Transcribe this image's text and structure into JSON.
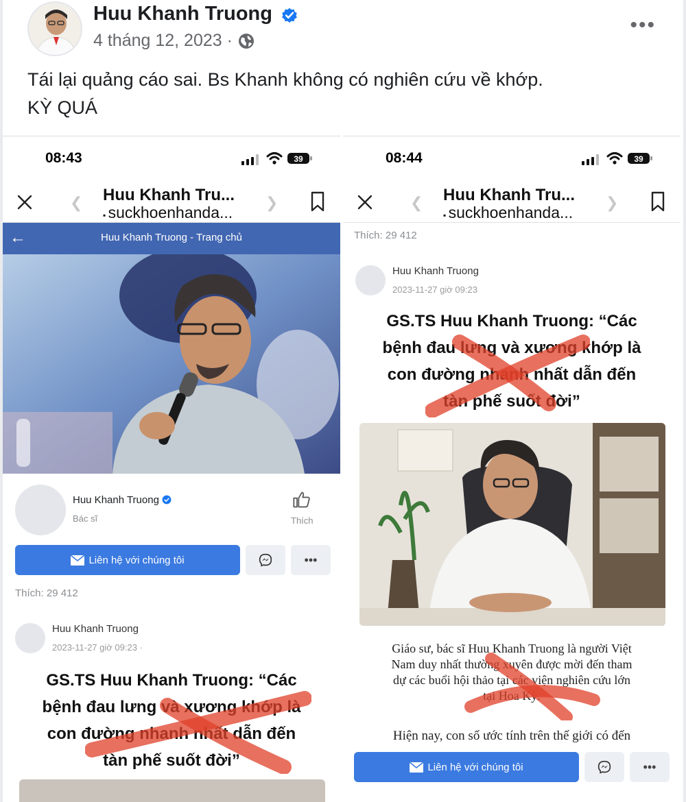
{
  "post": {
    "author": "Huu Khanh Truong",
    "date": "4 tháng 12, 2023 ·",
    "text_line1": "Tái lại quảng cáo sai. Bs Khanh không có nghiên cứu về khớp.",
    "text_line2": "KỲ QUÁ",
    "more_icon": "more-horizontal-icon"
  },
  "left_shot": {
    "time": "08:43",
    "battery": "39",
    "browser_title": "Huu Khanh Tru...",
    "browser_url": "suckhoenhanda...",
    "fb_bar_title": "Huu Khanh Truong - Trang chủ",
    "page_name": "Huu Khanh Truong",
    "page_category": "Bác sĩ",
    "like_label": "Thích",
    "contact_label": "Liên hệ với chúng tôi",
    "likes": "Thích: 29 412",
    "post_author": "Huu Khanh Truong",
    "post_date": "2023-11-27 giờ 09:23 ·",
    "headline": [
      "GS.TS Huu Khanh Truong: “Các",
      "bệnh đau lưng và xương khớp là",
      "con đường nhanh nhất dẫn đến",
      "tàn phế suốt đời”"
    ]
  },
  "right_shot": {
    "time": "08:44",
    "battery": "39",
    "browser_title": "Huu Khanh Tru...",
    "browser_url": "suckhoenhanda...",
    "likes": "Thích: 29 412",
    "post_author": "Huu Khanh Truong",
    "post_date": "2023-11-27 giờ 09:23",
    "headline": [
      "GS.TS Huu Khanh Truong: “Các",
      "bệnh đau lưng và xương khớp là",
      "con đường nhanh nhất dẫn đến",
      "tàn phế suốt đời”"
    ],
    "body": [
      "Giáo sư, bác sĩ Huu Khanh Truong là người Việt",
      "Nam duy nhất thường xuyên được mời đến tham",
      "dự các buổi hội thảo tại các viện nghiên cứu lớn",
      "tại Hoa Kỳ."
    ],
    "teaser": "Hiện nay, con số ước tính trên thế giới có đến",
    "contact_label": "Liên hệ với chúng tôi"
  },
  "colors": {
    "fb_blue": "#4267b2",
    "button_blue": "#3b7ae0",
    "verified_blue": "#1877f2",
    "cross_red": "#e0402a"
  }
}
